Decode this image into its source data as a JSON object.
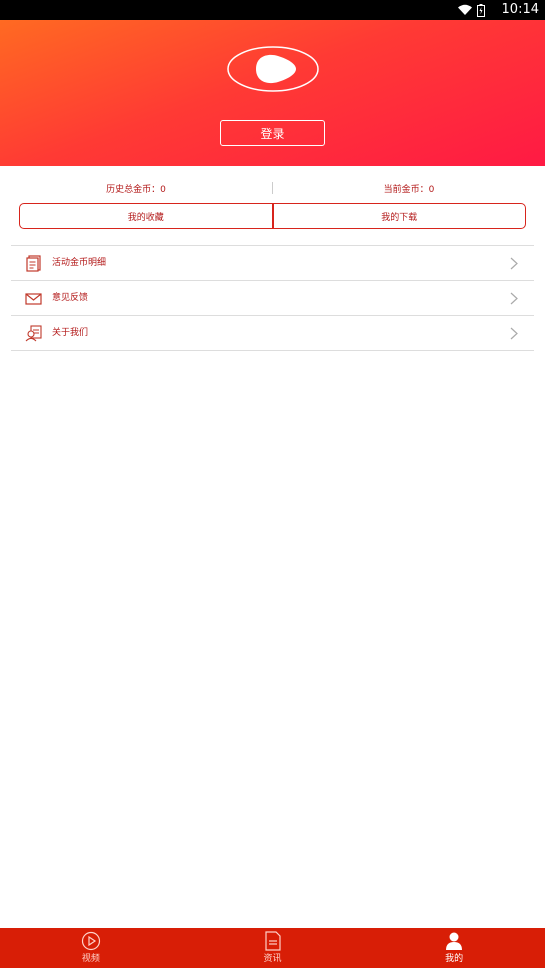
{
  "status_bar": {
    "time": "10:14",
    "icons": [
      "wifi-icon",
      "battery-icon"
    ]
  },
  "header": {
    "login_label": "登录",
    "logo_icon": "play-logo-icon"
  },
  "coins": {
    "history_total": "历史总金币：0",
    "current": "当前金币：0"
  },
  "tabs": [
    {
      "label": "我的收藏"
    },
    {
      "label": "我的下载"
    }
  ],
  "menu": [
    {
      "label": "活动金币明细",
      "icon": "document-icon"
    },
    {
      "label": "意见反馈",
      "icon": "envelope-icon"
    },
    {
      "label": "关于我们",
      "icon": "person-card-icon"
    }
  ],
  "tabbar": [
    {
      "label": "视频",
      "icon": "play-circle-icon",
      "active": false
    },
    {
      "label": "资讯",
      "icon": "news-document-icon",
      "active": false
    },
    {
      "label": "我的",
      "icon": "user-icon",
      "active": true
    }
  ],
  "colors": {
    "accent": "#d81e06",
    "header_start": "#ff6a22",
    "header_end": "#ff1a44",
    "text_red": "#b31a1a"
  }
}
